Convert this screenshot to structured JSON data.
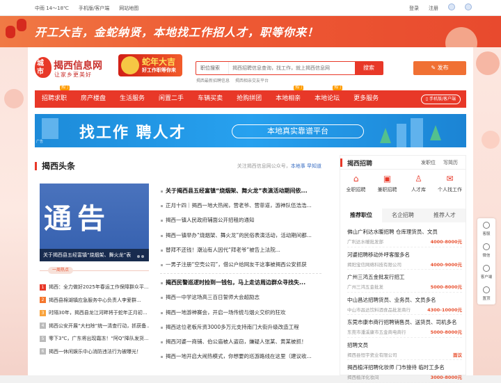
{
  "topbar": {
    "weather": "中雨 14～18℃",
    "mobile": "手机版/客户端",
    "sitemap": "网站地图",
    "login": "登录",
    "register": "注册"
  },
  "banner": {
    "text": "开工大吉，金蛇纳贤，本地找工作招人才，职等你来！"
  },
  "logo": {
    "badge": "城市",
    "name": "揭西信息网",
    "slogan": "让家乡更美好"
  },
  "promo": {
    "title": "蛇年大吉",
    "sub": "好工作职等你来"
  },
  "search": {
    "category": "职位搜索",
    "placeholder": "揭西招聘信息查询，找工作，就上揭西信息网",
    "button": "搜索",
    "hot": [
      "揭西最新招聘信息",
      "揭西相亲交友平台"
    ]
  },
  "publish": {
    "label": "发布"
  },
  "nav": {
    "items": [
      {
        "label": "招聘求职",
        "tag": "热门"
      },
      {
        "label": "房产楼盘"
      },
      {
        "label": "生活服务"
      },
      {
        "label": "闲置二手"
      },
      {
        "label": "车辆买卖"
      },
      {
        "label": "抢购拼团"
      },
      {
        "label": "本地相亲",
        "tag": "热门"
      },
      {
        "label": "本地论坛",
        "tag": "热门"
      },
      {
        "label": "更多服务"
      }
    ],
    "app": "手机版/客户端"
  },
  "ad": {
    "headline": "找工作 聘人才",
    "pill": "本地真实靠谱平台",
    "mark": "广告"
  },
  "headlines": {
    "title": "揭西头条",
    "more": "关注揭西信息网公众号，本地事 早知道",
    "more_a": "关注揭西信息网公众号，",
    "more_b": "本地事 早知道"
  },
  "focus": {
    "big": "通告",
    "caption": "关于揭西县五经富镇“烧烟架、舞火龙”表"
  },
  "hot": {
    "label": "一周热点",
    "items": [
      "揭西：全力做好2025年春运工作保障群众平...",
      "揭西县棉湖镇应急服务中心负责人李爱群...",
      "时隔30年，揭西县龙江河畔将于蛇年正月初...",
      "揭西公安开展“大扫除”统一清查行动，抓获备...",
      "零下3℃，广东将出现霜冻！“阿Q”降队发货...",
      "揭西一休闲娱乐中心消防违法行为被曝光！"
    ]
  },
  "news": {
    "items": [
      {
        "t": "关于揭西县五经富镇“烧烟架、舞火龙”表演活动期间依...",
        "b": true
      },
      {
        "t": "正月十四｜揭西一地大热闹，营老爷、营菲道，游神队伍浩浩..."
      },
      {
        "t": "揭西一镇人民政府辅面公开招租的通知"
      },
      {
        "t": "揭西一镇举办“烧烟架、舞火龙”的民俗表演活动，活动期间都..."
      },
      {
        "t": "替拜不还钱！潮汕有人因代“拜老爷”被告上法院..."
      },
      {
        "t": "一男子注册“空壳公司”，借公户给网友干这事被揭西公安抓获"
      },
      {
        "t": "揭西民警巡逻时捡到一钱包，马上走访周边群众寻找失...",
        "b": true
      },
      {
        "t": "揭西一中学这场高三百日誓师大会超励志"
      },
      {
        "t": "揭西一地游神赛会，开启一场传统与烟火交织的狂欢"
      },
      {
        "t": "揭西这位老板斥资3000多万元支持南门大街升级改造工程"
      },
      {
        "t": "揭西河婆一商铺、伯公庙被人盗窃，嫌疑人张某、黄某被抓！"
      },
      {
        "t": "揭西一地开启大闹热模式，你想要的巡游路线在这里（建议收..."
      }
    ]
  },
  "recruit": {
    "title": "揭西招聘",
    "link1": "发职位",
    "link2": "写简历",
    "icons": [
      {
        "label": "全职招聘",
        "g": "⌂"
      },
      {
        "label": "兼职招聘",
        "g": "▣"
      },
      {
        "label": "人才库",
        "g": "♙"
      },
      {
        "label": "个人找工作",
        "g": "✉"
      }
    ],
    "tabs": [
      "推荐职位",
      "名企招聘",
      "推荐人才"
    ],
    "jobs": [
      {
        "t": "佛山广利达水暖招聘 仓库理货员、文员",
        "c": "广利达水暖批发部",
        "s": "4000-8000元"
      },
      {
        "t": "河婆招聘移动外呼客服多名",
        "c": "揭阳宝信网络科技有限公司",
        "s": "4000-9000元"
      },
      {
        "t": "广州三鸿五金批发行招工",
        "c": "广州三鸿五金批发",
        "s": "5000-8000元"
      },
      {
        "t": "中山昌达招聘货员、业务员、文员多名",
        "c": "中山市昌达饮料酒食品批发商行",
        "s": "4300-10000元"
      },
      {
        "t": "东莞市康市商行招聘销售员、送货员、司机多名",
        "c": "东莞市潘溪康市五金商电商行",
        "s": "5000-8000元"
      },
      {
        "t": "招聘文员",
        "c": "揭西县恒宇瓷业有限公司",
        "s": "面议"
      },
      {
        "t": "揭西植洋招聘化妆师 门市接待 临时工多名",
        "c": "揭西植洋化妆间",
        "s": "3000-8000元"
      }
    ]
  },
  "float": [
    "客服",
    "微信",
    "客户端",
    "置顶"
  ]
}
